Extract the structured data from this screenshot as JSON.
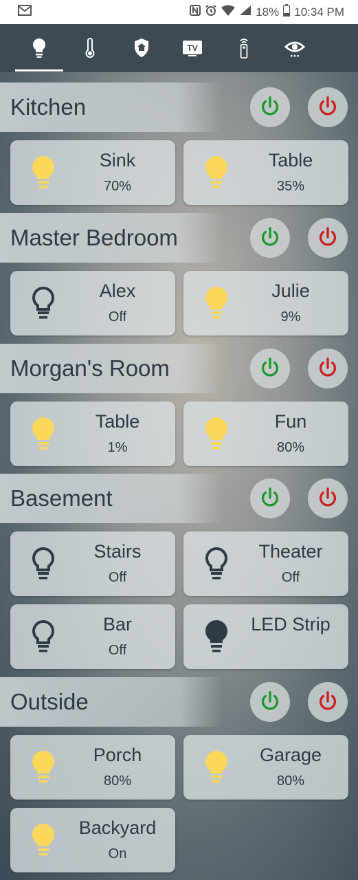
{
  "status_bar": {
    "battery": "18%",
    "time": "10:34 PM"
  },
  "tabs": [
    {
      "name": "lights",
      "icon": "bulb-icon"
    },
    {
      "name": "climate",
      "icon": "thermometer-icon"
    },
    {
      "name": "security",
      "icon": "shield-home-icon"
    },
    {
      "name": "media",
      "icon": "tv-icon",
      "text": "TV"
    },
    {
      "name": "remote",
      "icon": "remote-icon"
    },
    {
      "name": "camera",
      "icon": "eye-icon"
    }
  ],
  "colors": {
    "on_green": "#1a9a2a",
    "off_red": "#cc1f1f",
    "bulb_on": "#fbd75b",
    "bulb_off": "#2f3a44"
  },
  "rooms": [
    {
      "title": "Kitchen",
      "lights": [
        {
          "name": "Sink",
          "state": "70%"
        },
        {
          "name": "Table",
          "state": "35%"
        }
      ]
    },
    {
      "title": "Master Bedroom",
      "lights": [
        {
          "name": "Alex",
          "state": "Off"
        },
        {
          "name": "Julie",
          "state": "9%"
        }
      ]
    },
    {
      "title": "Morgan's Room",
      "lights": [
        {
          "name": "Table",
          "state": "1%"
        },
        {
          "name": "Fun",
          "state": "80%"
        }
      ]
    },
    {
      "title": "Basement",
      "lights": [
        {
          "name": "Stairs",
          "state": "Off"
        },
        {
          "name": "Theater",
          "state": "Off"
        },
        {
          "name": "Bar",
          "state": "Off"
        },
        {
          "name": "LED Strip",
          "state": ""
        }
      ]
    },
    {
      "title": "Outside",
      "lights": [
        {
          "name": "Porch",
          "state": "80%"
        },
        {
          "name": "Garage",
          "state": "80%"
        },
        {
          "name": "Backyard",
          "state": "On"
        }
      ]
    }
  ]
}
